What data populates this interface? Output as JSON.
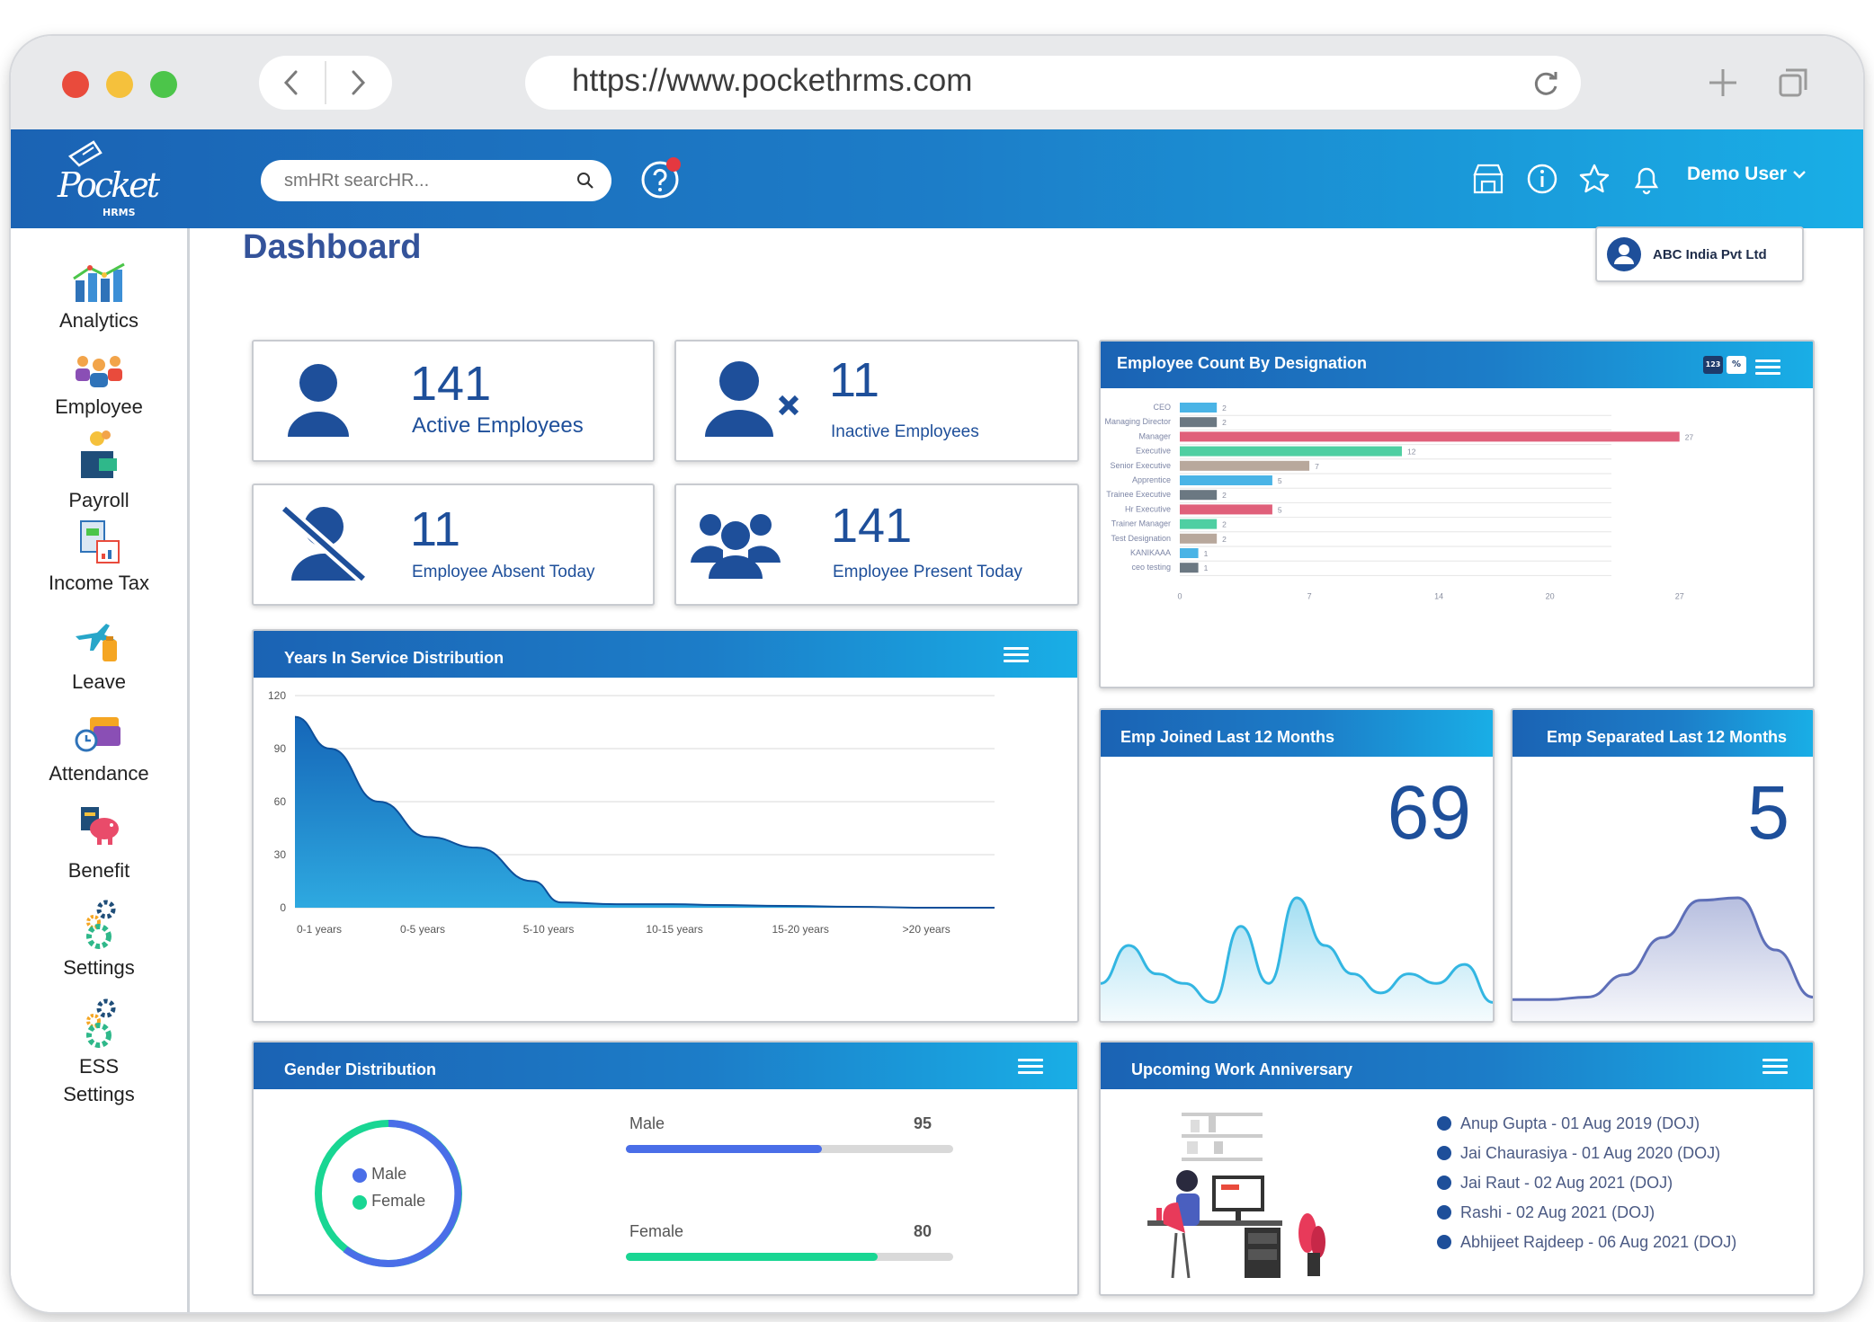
{
  "browser": {
    "url": "https://www.pockethrms.com",
    "traffic_colors": [
      "#e94b3c",
      "#f5c13c",
      "#4cc54a"
    ]
  },
  "header": {
    "logo_text": "Pocket",
    "logo_sub": "HRMS",
    "search_placeholder": "smHRt searcHR...",
    "user_name": "Demo User",
    "gradient": [
      "#1b63b4",
      "#19aee6"
    ],
    "notification_color": "#e53840"
  },
  "sidebar": {
    "items": [
      {
        "label": "Analytics",
        "icon": "analytics-icon"
      },
      {
        "label": "Employee",
        "icon": "employee-icon"
      },
      {
        "label": "Payroll",
        "icon": "payroll-icon"
      },
      {
        "label": "Income Tax",
        "icon": "income-tax-icon"
      },
      {
        "label": "Leave",
        "icon": "leave-icon"
      },
      {
        "label": "Attendance",
        "icon": "attendance-icon"
      },
      {
        "label": "Benefit",
        "icon": "benefit-icon"
      },
      {
        "label": "Settings",
        "icon": "settings-icon"
      },
      {
        "label": "ESS",
        "label2": "Settings",
        "icon": "ess-settings-icon"
      }
    ]
  },
  "page": {
    "title": "Dashboard",
    "company": "ABC India Pvt Ltd"
  },
  "stats": {
    "active": {
      "value": "141",
      "label": "Active Employees"
    },
    "inactive": {
      "value": "11",
      "label": "Inactive Employees"
    },
    "absent": {
      "value": "11",
      "label": "Employee Absent Today"
    },
    "present": {
      "value": "141",
      "label": "Employee Present Today"
    }
  },
  "designation_panel": {
    "title": "Employee Count By Designation",
    "toggle_labels": [
      "123",
      "%"
    ]
  },
  "years_panel": {
    "title": "Years In Service Distribution"
  },
  "joined_panel": {
    "title": "Emp Joined Last 12 Months",
    "value": "69"
  },
  "separated_panel": {
    "title": "Emp Separated Last 12 Months",
    "value": "5"
  },
  "gender_panel": {
    "title": "Gender Distribution",
    "legend": [
      "Male",
      "Female"
    ],
    "male": {
      "label": "Male",
      "value": "95",
      "fraction": 0.6
    },
    "female": {
      "label": "Female",
      "value": "80",
      "fraction": 0.77
    },
    "colors": {
      "male": "#4a6ee8",
      "female": "#19d693"
    }
  },
  "anniversary_panel": {
    "title": "Upcoming Work Anniversary",
    "items": [
      "Anup Gupta - 01 Aug 2019 (DOJ)",
      "Jai Chaurasiya - 01 Aug 2020 (DOJ)",
      "Jai Raut - 02 Aug 2021 (DOJ)",
      "Rashi - 02 Aug 2021 (DOJ)",
      "Abhijeet Rajdeep - 06 Aug 2021 (DOJ)"
    ]
  },
  "chart_data": [
    {
      "type": "bar",
      "orientation": "horizontal",
      "title": "Employee Count By Designation",
      "categories": [
        "CEO",
        "Managing Director",
        "Manager",
        "Executive",
        "Senior Executive",
        "Apprentice",
        "Trainee Executive",
        "Hr Executive",
        "Trainer Manager",
        "Test Designation",
        "KANIKAAA",
        "ceo testing"
      ],
      "values": [
        2,
        2,
        27,
        12,
        7,
        5,
        2,
        5,
        2,
        2,
        1,
        1
      ],
      "colors": [
        "#4ab4e6",
        "#6b7882",
        "#e0607a",
        "#4fcfa2",
        "#b8a89c",
        "#4ab4e6",
        "#6b7882",
        "#e0607a",
        "#4fcfa2",
        "#b8a89c",
        "#4ab4e6",
        "#6b7882"
      ],
      "xticks": [
        0,
        7,
        14,
        20,
        27
      ],
      "xlim": [
        0,
        33
      ],
      "grid": true
    },
    {
      "type": "area",
      "title": "Years In Service Distribution",
      "categories": [
        "0-1 years",
        "0-5 years",
        "5-10 years",
        "10-15 years",
        "15-20 years",
        ">20 years"
      ],
      "x": [
        0,
        0.25,
        0.6,
        0.95,
        1.3,
        1.7,
        1.9,
        2.3,
        2.7,
        3.0,
        3.5,
        4.0,
        4.5,
        5.0
      ],
      "y": [
        108,
        90,
        60,
        40,
        34,
        15,
        3,
        2,
        2,
        1.5,
        1,
        0.5,
        0,
        0
      ],
      "yticks": [
        0,
        30,
        60,
        90,
        120
      ],
      "ylim": [
        0,
        120
      ],
      "color": "#1a78c8",
      "grid": true
    },
    {
      "type": "area",
      "title": "Emp Joined Last 12 Months",
      "x": [
        0,
        1,
        2,
        3,
        4,
        5,
        6,
        7,
        8,
        9,
        10,
        11,
        12,
        13,
        14
      ],
      "y": [
        3,
        7,
        4,
        3,
        1,
        9,
        3,
        12,
        7,
        4,
        2,
        4,
        3,
        5,
        1
      ],
      "color": "#33b6e2"
    },
    {
      "type": "area",
      "title": "Emp Separated Last 12 Months",
      "x": [
        0,
        1,
        2,
        3,
        4,
        5,
        6,
        7,
        8
      ],
      "y": [
        0.5,
        0.5,
        0.6,
        1.5,
        3.0,
        4.5,
        4.6,
        2.5,
        0.6
      ],
      "color": "#5e6fb8"
    }
  ]
}
